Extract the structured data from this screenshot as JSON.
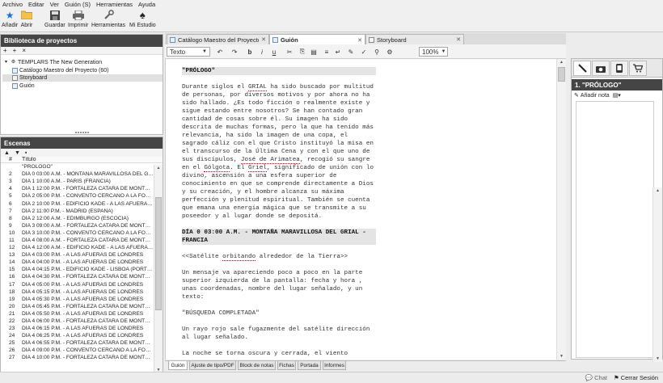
{
  "menu": [
    "Archivo",
    "Editar",
    "Ver",
    "Guión (S)",
    "Herramientas",
    "Ayuda"
  ],
  "toolbar": {
    "add": "Añadir",
    "open": "Abrir",
    "save": "Guardar",
    "print": "Imprimir",
    "tools": "Herramientas",
    "studio": "Mi Estudio"
  },
  "library": {
    "title": "Biblioteca de proyectos",
    "project": "TEMPLARS The New Generation",
    "items": [
      "Catálogo Maestro del Proyecto (60)",
      "Storyboard",
      "Guión"
    ]
  },
  "scenes": {
    "title": "Escenas",
    "col_num": "#",
    "col_title": "Título",
    "rows": [
      {
        "n": "",
        "t": "\"PRÓLOGO\""
      },
      {
        "n": "2",
        "t": "DÍA 0 03:00 A.M. - MONTAÑA MARAVILLOSA DEL GRIAL"
      },
      {
        "n": "3",
        "t": "DÍA 1 10:00 A.M. - PARÍS (FRANCIA)"
      },
      {
        "n": "4",
        "t": "DÍA 1 12:00 P.M. - FORTALEZA CATARA DE MONTSEGUR"
      },
      {
        "n": "5",
        "t": "DÍA 2 05:00 P.M. - CONVENTO CERCANO A LA FORTALEZA"
      },
      {
        "n": "6",
        "t": "DÍA 2 10:00 P.M. - EDIFICIO KADE - A LAS AFUERAS DE"
      },
      {
        "n": "7",
        "t": "DÍA 2 11:00 P.M. - MADRID (ESPAÑA)"
      },
      {
        "n": "8",
        "t": "DÍA 2 12:00 A.M. - EDIMBURGO (ESCOCIA)"
      },
      {
        "n": "9",
        "t": "DÍA 3 09:00 A.M. - FORTALEZA CATARA DE MONTSEGUR"
      },
      {
        "n": "10",
        "t": "DÍA 3 10:00 P.M. - CONVENTO CERCANO A LA FORTALEZA"
      },
      {
        "n": "11",
        "t": "DÍA 4 08:00 A.M. - FORTALEZA CATARA DE MONTSEGUR"
      },
      {
        "n": "12",
        "t": "DÍA 4 12:00 A.M. - EDIFICIO KADE - A LAS AFUERAS DE"
      },
      {
        "n": "13",
        "t": "DÍA 4 03:00 P.M. - A LAS AFUERAS DE LONDRES"
      },
      {
        "n": "14",
        "t": "DÍA 4 04:00 P.M. - A LAS AFUERAS DE LONDRES"
      },
      {
        "n": "15",
        "t": "DÍA 4 04:15 P.M. - EDIFICIO KADE - LISBOA (PORTUGAL)"
      },
      {
        "n": "16",
        "t": "DÍA 4 04:30 P.M. - FORTALEZA CATARA DE MONTSEGUR"
      },
      {
        "n": "17",
        "t": "DÍA 4 05:00 P.M. - A LAS AFUERAS DE LONDRES"
      },
      {
        "n": "18",
        "t": "DÍA 4 05:15 P.M. - A LAS AFUERAS DE LONDRES"
      },
      {
        "n": "19",
        "t": "DÍA 4 05:30 P.M. - A LAS AFUERAS DE LONDRES"
      },
      {
        "n": "20",
        "t": "DÍA 4 05:45 P.M. - FORTALEZA CATARA DE MONTSEGUR"
      },
      {
        "n": "21",
        "t": "DÍA 4 05:50 P.M. - A LAS AFUERAS DE LONDRES"
      },
      {
        "n": "22",
        "t": "DÍA 4 06:00 P.M. - FORTALEZA CATARA DE MONTSEGUR"
      },
      {
        "n": "23",
        "t": "DÍA 4 06:15 P.M. - A LAS AFUERAS DE LONDRES"
      },
      {
        "n": "24",
        "t": "DÍA 4 06:25 P.M. - A LAS AFUERAS DE LONDRES"
      },
      {
        "n": "25",
        "t": "DÍA 4 06:55 P.M. - FORTALEZA CATARA DE MONTSEGUR"
      },
      {
        "n": "26",
        "t": "DÍA 4 09:00 P.M. - CONVENTO CERCANO A LA FORTALEZA"
      },
      {
        "n": "27",
        "t": "DÍA 4 10:00 P.M. - FORTALEZA CATARA DE MONTSEGUR"
      }
    ]
  },
  "tabs": [
    "Catálogo Maestro del Proyecto",
    "Guión",
    "Storyboard"
  ],
  "format": {
    "style": "Texto",
    "zoom": "100%"
  },
  "script": {
    "heading1": "\"PRÓLOGO\"",
    "para1_a": "Durante siglos el ",
    "para1_grial": "GRIAL",
    "para1_b": " ha sido buscado por multitud de personas, por diversos motivos y por ahora no ha sido hallado. ¿Es todo ficción o realmente existe y sigue estando entre nosotros? Se han contado gran cantidad de cosas sobre él. Su imagen ha sido descrita de muchas formas, pero la que ha tenido más relevancia, ha sido la imagen de una copa, el sagrado cáliz con el que Cristo instituyó la misa en el transcurso de la Última Cena y con el que uno de sus discípulos, ",
    "para1_jose": "José de Arimatea",
    "para1_c": ", recogió su sangre en el ",
    "para1_golgota": "Gólgota",
    "para1_d": ". El ",
    "para1_griel": "Griel",
    "para1_e": ", significado de unión con lo divino, ascensión a una esfera superior de conocimiento en que se comprende directamente a Dios y su creación, y el hombre alcanza su máxima perfección y plenitud espiritual. También se cuenta que emana una energía mágica que se transmite a su poseedor y al lugar donde se depositá.",
    "heading2": "DÍA 0 03:00 A.M. - MONTAÑA MARAVILLOSA DEL GRIAL - FRANCIA",
    "para2_a": "<<Satélite ",
    "para2_orb": "orbitando",
    "para2_b": " alrededor de la Tierra>>",
    "para3": "Un mensaje va apareciendo poco a poco en la parte superior izquierda de la pantalla: fecha y hora , unas coordenadas, nombre del lugar señalado, y un texto:",
    "para4": "\"BÚSQUEDA COMPLETADA\"",
    "para5": "Un rayo rojo sale fugazmente del satélite dirección al lugar señalado.",
    "para6": "La noche se torna oscura y cerrada, el viento"
  },
  "bottom_tabs": [
    "Guión",
    "Ajuste de tipo/PDF",
    "Block de notas",
    "Fichas",
    "Portada",
    "Informes"
  ],
  "right_panel": {
    "scene": "1. \"PRÓLOGO\"",
    "add_note": "Añadir nota"
  },
  "status": {
    "chat": "Chat",
    "logout": "Cerrar Sesión"
  }
}
